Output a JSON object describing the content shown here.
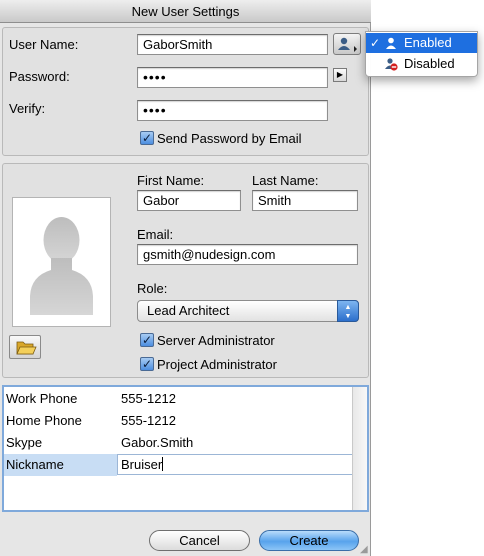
{
  "window": {
    "title": "New User Settings"
  },
  "account": {
    "username_label": "User Name:",
    "username_value": "GaborSmith",
    "password_label": "Password:",
    "password_value": "••••",
    "verify_label": "Verify:",
    "verify_value": "••••",
    "send_email_label": "Send Password by Email",
    "send_email_checked": true
  },
  "status_menu": {
    "items": [
      {
        "label": "Enabled",
        "selected": true,
        "icon": "user-enabled-icon"
      },
      {
        "label": "Disabled",
        "selected": false,
        "icon": "user-disabled-icon"
      }
    ]
  },
  "profile": {
    "first_name_label": "First Name:",
    "first_name_value": "Gabor",
    "last_name_label": "Last Name:",
    "last_name_value": "Smith",
    "email_label": "Email:",
    "email_value": "gsmith@nudesign.com",
    "role_label": "Role:",
    "role_value": "Lead Architect",
    "server_admin_label": "Server Administrator",
    "server_admin_checked": true,
    "project_admin_label": "Project Administrator",
    "project_admin_checked": true
  },
  "info_table": {
    "rows": [
      {
        "key": "Work Phone",
        "value": "555-1212"
      },
      {
        "key": "Home Phone",
        "value": "555-1212"
      },
      {
        "key": "Skype",
        "value": "Gabor.Smith"
      },
      {
        "key": "Nickname",
        "value": "Bruiser"
      }
    ]
  },
  "buttons": {
    "cancel": "Cancel",
    "create": "Create"
  },
  "colors": {
    "accent": "#1e6fe0",
    "default_button": "#58a3ec",
    "selection": "#c8ddf4"
  }
}
